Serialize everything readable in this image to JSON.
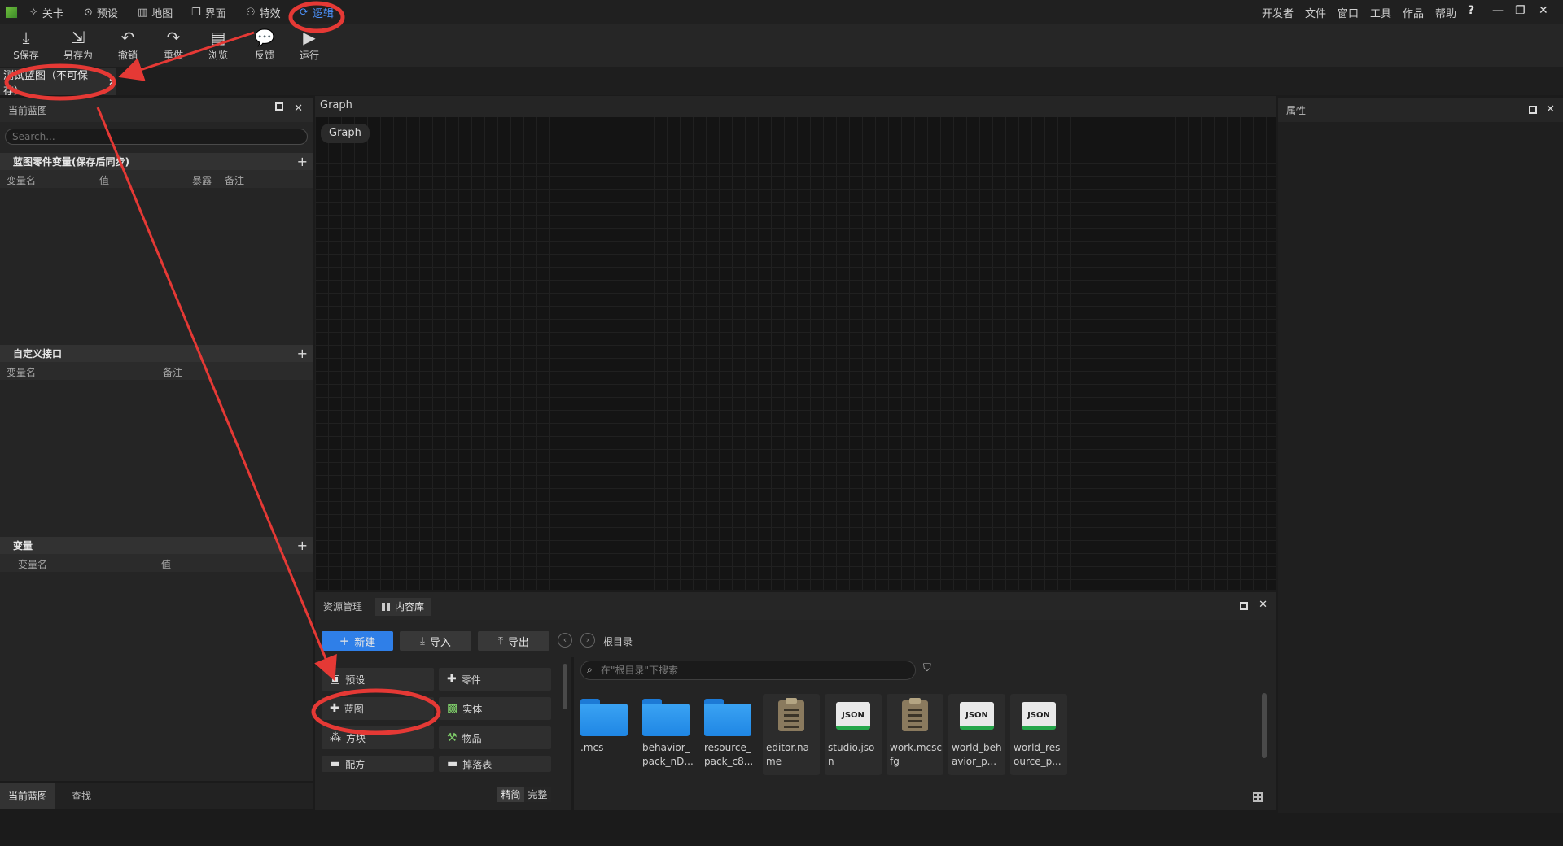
{
  "menubar": {
    "tabs": [
      {
        "icon": "level-icon",
        "label": "关卡"
      },
      {
        "icon": "preset-icon",
        "label": "预设"
      },
      {
        "icon": "map-icon",
        "label": "地图"
      },
      {
        "icon": "ui-icon",
        "label": "界面"
      },
      {
        "icon": "effects-icon",
        "label": "特效"
      },
      {
        "icon": "logic-icon",
        "label": "逻辑"
      }
    ],
    "right_menu": [
      "开发者",
      "文件",
      "窗口",
      "工具",
      "作品",
      "帮助"
    ],
    "help_icon_label": "?",
    "accent_color": "#4c8ff5"
  },
  "toolbar": {
    "buttons": [
      {
        "icon": "save-icon",
        "label": "S保存"
      },
      {
        "icon": "save-as-icon",
        "label": "另存为"
      },
      {
        "icon": "undo-icon",
        "label": "撤销"
      },
      {
        "icon": "redo-icon",
        "label": "重做"
      },
      {
        "icon": "browse-icon",
        "label": "浏览"
      },
      {
        "icon": "feedback-icon",
        "label": "反馈"
      },
      {
        "icon": "run-icon",
        "label": "运行"
      }
    ]
  },
  "doc_tab": {
    "label": "测试蓝图（不可保存）"
  },
  "left_panel": {
    "title": "当前蓝图",
    "search_placeholder": "Search...",
    "sections": [
      {
        "title": "蓝图零件变量(保存后同步)",
        "columns": [
          "变量名",
          "值",
          "暴露",
          "备注"
        ]
      },
      {
        "title": "自定义接口",
        "columns": [
          "变量名",
          "备注"
        ]
      },
      {
        "title": "变量",
        "columns": [
          "变量名",
          "值"
        ]
      }
    ],
    "bottom_tabs": [
      "当前蓝图",
      "查找"
    ]
  },
  "graph": {
    "header": "Graph",
    "breadcrumb": "Graph"
  },
  "right_panel": {
    "title": "属性"
  },
  "resources": {
    "tabs": [
      "资源管理",
      "内容库"
    ],
    "buttons": {
      "new": "新建",
      "import": "导入",
      "export": "导出"
    },
    "path": "根目录",
    "search_placeholder": "在\"根目录\"下搜索",
    "categories": [
      {
        "icon": "preset-icon",
        "label": "预设"
      },
      {
        "icon": "part-icon",
        "label": "零件"
      },
      {
        "icon": "blueprint-icon",
        "label": "蓝图"
      },
      {
        "icon": "entity-icon",
        "label": "实体"
      },
      {
        "icon": "block-icon",
        "label": "方块"
      },
      {
        "icon": "item-icon",
        "label": "物品"
      },
      {
        "icon": "recipe-icon",
        "label": "配方"
      },
      {
        "icon": "loot-table-icon",
        "label": "掉落表"
      }
    ],
    "view_modes": [
      "精简",
      "完整"
    ],
    "files": [
      {
        "type": "folder",
        "label": ".mcs"
      },
      {
        "type": "folder",
        "label": "behavior_pack_nD..."
      },
      {
        "type": "folder",
        "label": "resource_pack_c8..."
      },
      {
        "type": "clipboard",
        "label": "editor.name"
      },
      {
        "type": "json",
        "label": "studio.json"
      },
      {
        "type": "clipboard",
        "label": "work.mcscfg"
      },
      {
        "type": "json",
        "label": "world_behavior_p..."
      },
      {
        "type": "json",
        "label": "world_resource_p..."
      }
    ],
    "json_badge": "JSON",
    "primary_color": "#2f7fe8"
  },
  "annotation_color": "#e53935"
}
